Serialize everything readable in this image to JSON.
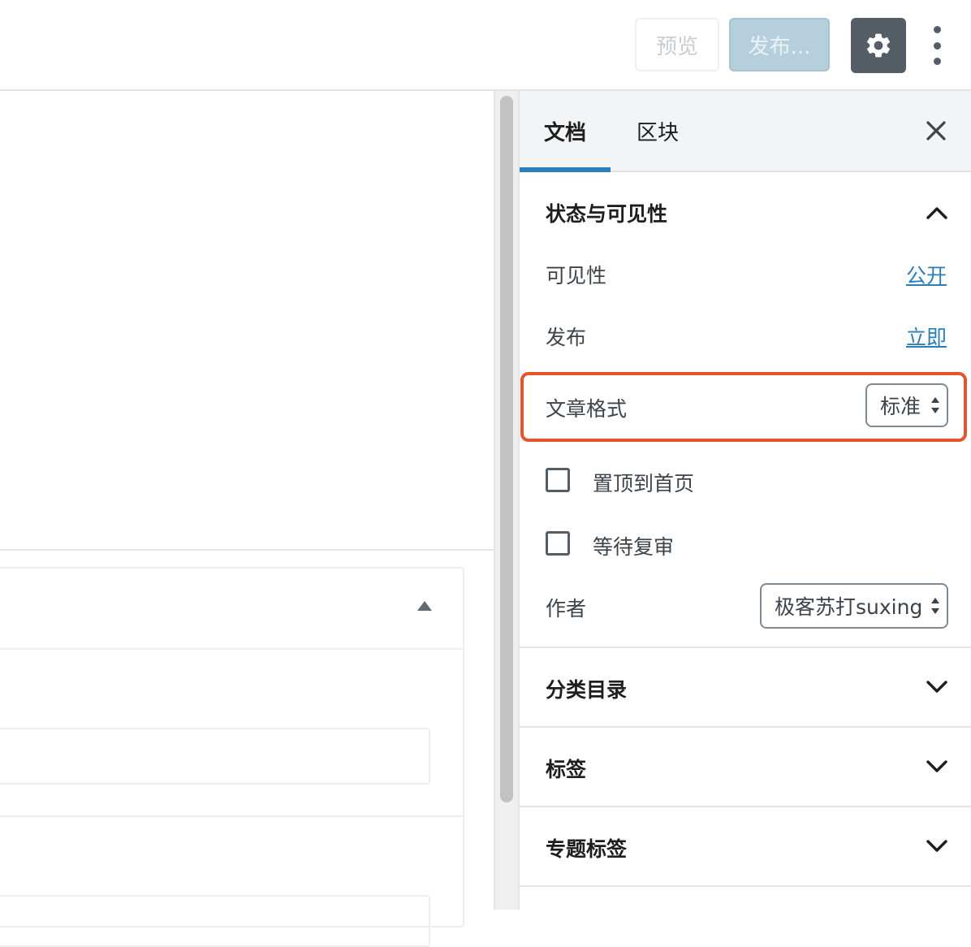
{
  "toolbar": {
    "preview_label": "预览",
    "publish_label": "发布...",
    "settings_icon": "gear-icon",
    "more_icon": "vertical-ellipsis-icon"
  },
  "sidebar": {
    "tabs": [
      {
        "label": "文档",
        "active": true
      },
      {
        "label": "区块",
        "active": false
      }
    ],
    "close_icon": "close-icon",
    "status_section": {
      "title": "状态与可见性",
      "expanded": true,
      "visibility_label": "可见性",
      "visibility_value": "公开",
      "publish_label": "发布",
      "publish_value": "立即",
      "format_label": "文章格式",
      "format_value": "标准",
      "sticky_label": "置顶到首页",
      "sticky_checked": false,
      "pending_label": "等待复审",
      "pending_checked": false,
      "author_label": "作者",
      "author_value": "极客苏打suxing"
    },
    "sections": [
      {
        "title": "分类目录",
        "expanded": false
      },
      {
        "title": "标签",
        "expanded": false
      },
      {
        "title": "专题标签",
        "expanded": false
      }
    ]
  },
  "colors": {
    "accent": "#2b7fb8",
    "highlight": "#e8522d",
    "settings_bg": "#555d66"
  }
}
